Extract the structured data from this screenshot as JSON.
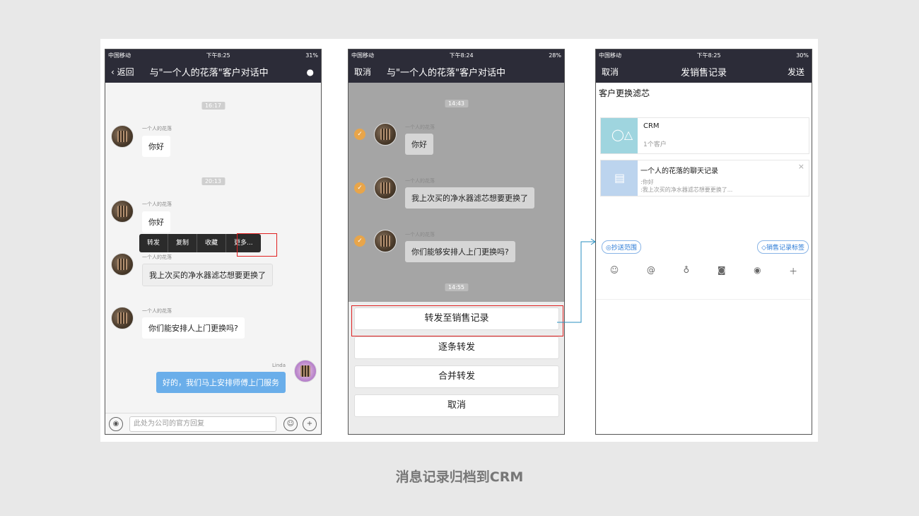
{
  "phone1": {
    "status": {
      "left": "中国移动",
      "time": "下午8:25",
      "right": "31%"
    },
    "nav": {
      "back": "返回",
      "title": "与\"一个人的花落\"客户对话中"
    },
    "times": [
      "16:17",
      "20:13"
    ],
    "messages": [
      {
        "sender": "一个人的花落",
        "text": "你好"
      },
      {
        "sender": "一个人的花落",
        "text": "你好"
      },
      {
        "sender": "一个人的花落",
        "text": "我上次买的净水器滤芯想要更换了"
      },
      {
        "sender": "一个人的花落",
        "text": "你们能安排人上门更换吗?"
      }
    ],
    "context_menu": [
      "转发",
      "复制",
      "收藏",
      "更多..."
    ],
    "reply": {
      "sender": "Linda",
      "text": "好的，我们马上安排师傅上门服务"
    },
    "input_placeholder": "此处为公司的官方回复"
  },
  "phone2": {
    "status": {
      "left": "中国移动",
      "time": "下午8:24",
      "right": "28%"
    },
    "nav": {
      "cancel": "取消",
      "title": "与\"一个人的花落\"客户对话中"
    },
    "times": [
      "14:43",
      "14:55"
    ],
    "messages": [
      {
        "sender": "一个人的花落",
        "text": "你好"
      },
      {
        "sender": "一个人的花落",
        "text": "我上次买的净水器滤芯想要更换了"
      },
      {
        "sender": "一个人的花落",
        "text": "你们能够安排人上门更换吗?"
      }
    ],
    "sheet": [
      "转发至销售记录",
      "逐条转发",
      "合并转发",
      "取消"
    ]
  },
  "phone3": {
    "status": {
      "left": "中国移动",
      "time": "下午8:25",
      "right": "30%"
    },
    "nav": {
      "cancel": "取消",
      "title": "发销售记录",
      "send": "发送"
    },
    "note": "客户更换滤芯",
    "crm_card": {
      "title": "CRM",
      "subtitle": "1个客户"
    },
    "chat_card": {
      "title": "一个人的花落的聊天记录",
      "line1": ":你好",
      "line2": ":我上次买的净水器滤芯想要更换了..."
    },
    "cc_tag": "抄送范围",
    "record_tag": "销售记录标签"
  },
  "caption": "消息记录归档到CRM",
  "colors": {
    "nav": "#2c2c38",
    "highlight": "#e02020",
    "connector": "#2a8fc0",
    "tag": "#2a7ad6"
  }
}
